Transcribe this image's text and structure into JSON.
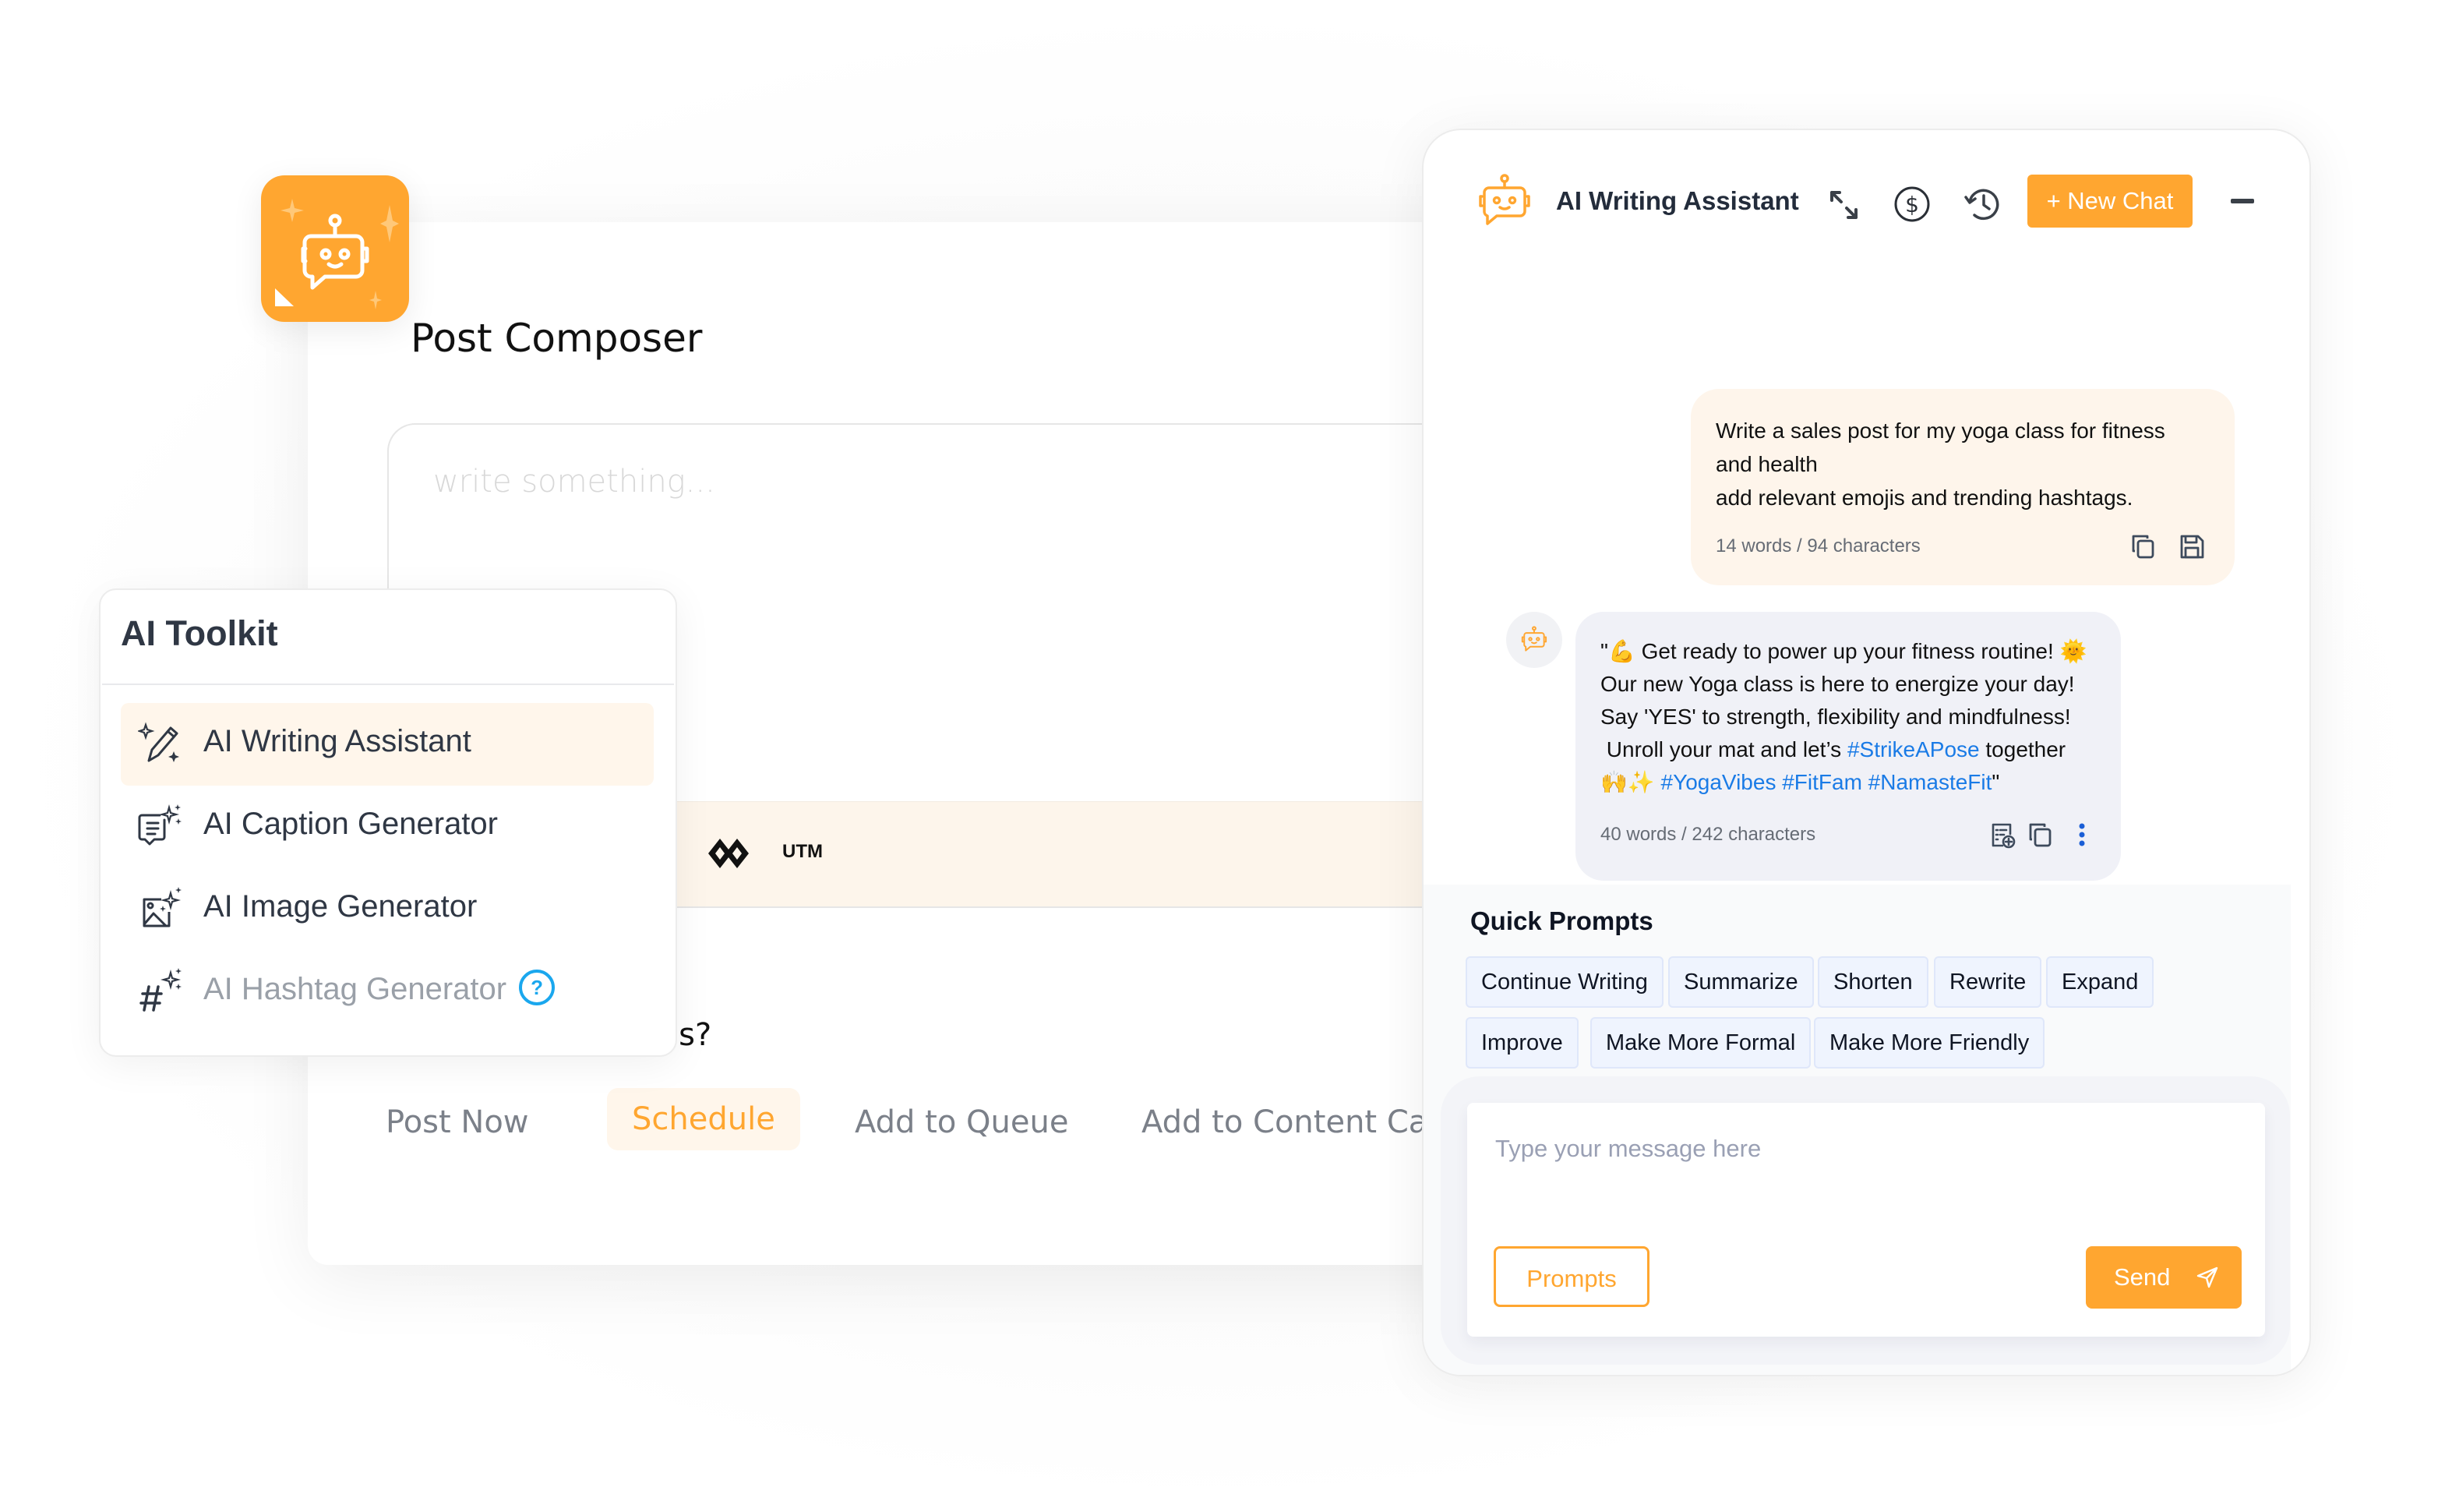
{
  "colors": {
    "accent": "#FFA630",
    "accent_light": "#FFF6EB",
    "hashtag": "#1a7be6",
    "help": "#1aa7ee"
  },
  "app_icon": {
    "icon": "robot-chat-icon"
  },
  "composer": {
    "title": "Post Composer",
    "editor_placeholder": "write something...",
    "utm_label": "UTM",
    "question_fragment": "is?",
    "tabs": [
      {
        "label": "Post Now",
        "active": false
      },
      {
        "label": "Schedule",
        "active": true
      },
      {
        "label": "Add to Queue",
        "active": false
      },
      {
        "label": "Add to Content Cate",
        "active": false
      }
    ]
  },
  "toolkit": {
    "title": "AI Toolkit",
    "items": [
      {
        "label": "AI Writing Assistant",
        "icon": "sparkle-pencil-icon",
        "active": true,
        "disabled": false
      },
      {
        "label": "AI Caption Generator",
        "icon": "sparkle-caption-icon",
        "active": false,
        "disabled": false
      },
      {
        "label": "AI Image Generator",
        "icon": "sparkle-image-icon",
        "active": false,
        "disabled": false
      },
      {
        "label": "AI Hashtag Generator",
        "icon": "sparkle-hashtag-icon",
        "active": false,
        "disabled": true,
        "help": "?"
      }
    ]
  },
  "chat": {
    "title": "AI Writing Assistant",
    "header_icons": [
      "expand-icon",
      "dollar-credit-icon",
      "history-icon"
    ],
    "new_chat_label": "+ New Chat",
    "user_message": {
      "lines": [
        "Write a sales post for my yoga class for fitness",
        "and health",
        "add relevant emojis and trending hashtags."
      ],
      "meta": "14 words / 94 characters"
    },
    "bot_message": {
      "line1_prefix": "\"💪 Get ready to power up your fitness routine! 🌞",
      "line2": "Our new Yoga class is here to energize your day!",
      "line3": "Say 'YES' to strength, flexibility and mindfulness!",
      "line4_prefix": " Unroll your mat and let’s ",
      "line4_tag": "#StrikeAPose",
      "line4_suffix": " together",
      "line5_prefix": "🙌✨ ",
      "line5_tags": "#YogaVibes #FitFam #NamasteFit",
      "line5_suffix": "\"",
      "meta": "40 words / 242 characters"
    },
    "quick_prompts": {
      "title": "Quick Prompts",
      "chips": [
        "Continue Writing",
        "Summarize",
        "Shorten",
        "Rewrite",
        "Expand",
        "Improve",
        "Make More Formal",
        "Make More Friendly"
      ]
    },
    "input": {
      "placeholder": "Type your message here",
      "value": ""
    },
    "prompts_button": "Prompts",
    "send_button": "Send"
  }
}
